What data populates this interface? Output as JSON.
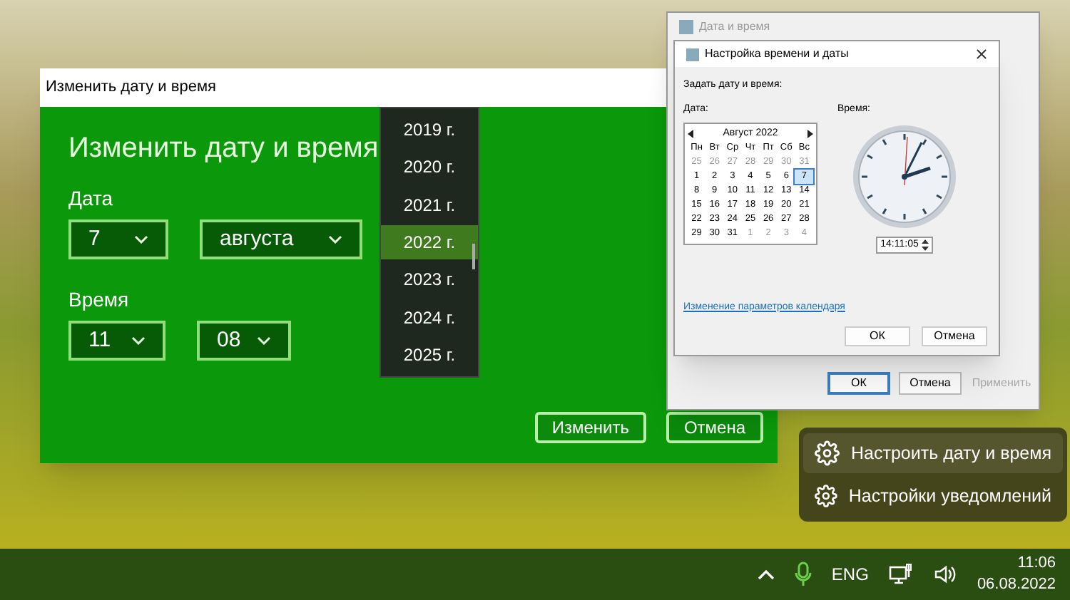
{
  "green_dialog": {
    "title": "Изменить дату и время",
    "heading": "Изменить дату и время",
    "date_label": "Дата",
    "day": "7",
    "month": "августа",
    "time_label": "Время",
    "hour": "11",
    "minute": "08",
    "buttons": [
      "Изменить",
      "Отмена"
    ]
  },
  "year_list": [
    {
      "label": "2019 г.",
      "selected": false
    },
    {
      "label": "2020 г.",
      "selected": false
    },
    {
      "label": "2021 г.",
      "selected": false
    },
    {
      "label": "2022 г.",
      "selected": true
    },
    {
      "label": "2023 г.",
      "selected": false
    },
    {
      "label": "2024 г.",
      "selected": false
    },
    {
      "label": "2025 г.",
      "selected": false
    }
  ],
  "datetime_window": {
    "title": "Дата и время",
    "buttons": [
      {
        "label": "ОК",
        "default": true,
        "disabled": false
      },
      {
        "label": "Отмена",
        "default": false,
        "disabled": false
      },
      {
        "label": "Применить",
        "default": false,
        "disabled": true
      }
    ]
  },
  "settings_dialog": {
    "title": "Настройка времени и даты",
    "prompt": "Задать дату и время:",
    "date_label": "Дата:",
    "time_label": "Время:",
    "calendar": {
      "month": "Август 2022",
      "weekdays": [
        "Пн",
        "Вт",
        "Ср",
        "Чт",
        "Пт",
        "Сб",
        "Вс"
      ],
      "weeks": [
        [
          {
            "text": "25",
            "other_month": true,
            "selected": false
          },
          {
            "text": "26",
            "other_month": true,
            "selected": false
          },
          {
            "text": "27",
            "other_month": true,
            "selected": false
          },
          {
            "text": "28",
            "other_month": true,
            "selected": false
          },
          {
            "text": "29",
            "other_month": true,
            "selected": false
          },
          {
            "text": "30",
            "other_month": true,
            "selected": false
          },
          {
            "text": "31",
            "other_month": true,
            "selected": false
          }
        ],
        [
          {
            "text": "1",
            "other_month": false,
            "selected": false
          },
          {
            "text": "2",
            "other_month": false,
            "selected": false
          },
          {
            "text": "3",
            "other_month": false,
            "selected": false
          },
          {
            "text": "4",
            "other_month": false,
            "selected": false
          },
          {
            "text": "5",
            "other_month": false,
            "selected": false
          },
          {
            "text": "6",
            "other_month": false,
            "selected": false
          },
          {
            "text": "7",
            "other_month": false,
            "selected": true
          }
        ],
        [
          {
            "text": "8",
            "other_month": false,
            "selected": false
          },
          {
            "text": "9",
            "other_month": false,
            "selected": false
          },
          {
            "text": "10",
            "other_month": false,
            "selected": false
          },
          {
            "text": "11",
            "other_month": false,
            "selected": false
          },
          {
            "text": "12",
            "other_month": false,
            "selected": false
          },
          {
            "text": "13",
            "other_month": false,
            "selected": false
          },
          {
            "text": "14",
            "other_month": false,
            "selected": false
          }
        ],
        [
          {
            "text": "15",
            "other_month": false,
            "selected": false
          },
          {
            "text": "16",
            "other_month": false,
            "selected": false
          },
          {
            "text": "17",
            "other_month": false,
            "selected": false
          },
          {
            "text": "18",
            "other_month": false,
            "selected": false
          },
          {
            "text": "19",
            "other_month": false,
            "selected": false
          },
          {
            "text": "20",
            "other_month": false,
            "selected": false
          },
          {
            "text": "21",
            "other_month": false,
            "selected": false
          }
        ],
        [
          {
            "text": "22",
            "other_month": false,
            "selected": false
          },
          {
            "text": "23",
            "other_month": false,
            "selected": false
          },
          {
            "text": "24",
            "other_month": false,
            "selected": false
          },
          {
            "text": "25",
            "other_month": false,
            "selected": false
          },
          {
            "text": "26",
            "other_month": false,
            "selected": false
          },
          {
            "text": "27",
            "other_month": false,
            "selected": false
          },
          {
            "text": "28",
            "other_month": false,
            "selected": false
          }
        ],
        [
          {
            "text": "29",
            "other_month": false,
            "selected": false
          },
          {
            "text": "30",
            "other_month": false,
            "selected": false
          },
          {
            "text": "31",
            "other_month": false,
            "selected": false
          },
          {
            "text": "1",
            "other_month": true,
            "selected": false
          },
          {
            "text": "2",
            "other_month": true,
            "selected": false
          },
          {
            "text": "3",
            "other_month": true,
            "selected": false
          },
          {
            "text": "4",
            "other_month": true,
            "selected": false
          }
        ]
      ]
    },
    "time_value": "14:11:05",
    "link": "Изменение параметров календаря",
    "buttons": [
      "ОК",
      "Отмена"
    ]
  },
  "context_menu": [
    {
      "label": "Настроить дату и время",
      "hovered": true
    },
    {
      "label": "Настройки уведомлений",
      "hovered": false
    }
  ],
  "taskbar": {
    "language": "ENG",
    "time": "11:06",
    "date": "06.08.2022"
  }
}
